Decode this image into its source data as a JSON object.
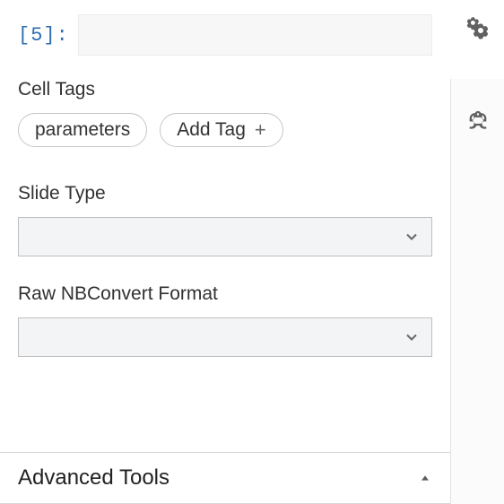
{
  "cell": {
    "prompt": "[5]:",
    "code": ""
  },
  "cellTags": {
    "label": "Cell Tags",
    "tags": [
      "parameters"
    ],
    "addLabel": "Add Tag"
  },
  "slideType": {
    "label": "Slide Type",
    "value": ""
  },
  "nbconvert": {
    "label": "Raw NBConvert Format",
    "value": ""
  },
  "advanced": {
    "label": "Advanced Tools"
  }
}
